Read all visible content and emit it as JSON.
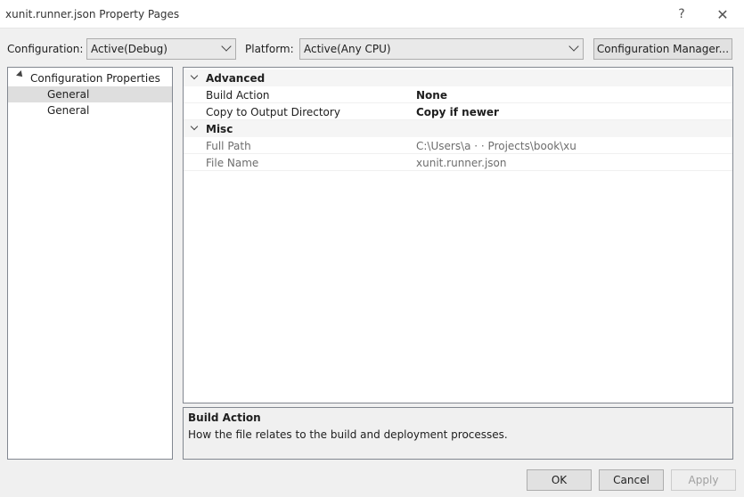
{
  "window": {
    "title": "xunit.runner.json Property Pages",
    "help_label": "?",
    "close_label": "✕"
  },
  "toolbar": {
    "configuration_label": "Configuration:",
    "configuration_value": "Active(Debug)",
    "platform_label": "Platform:",
    "platform_value": "Active(Any CPU)",
    "config_manager_label": "Configuration Manager..."
  },
  "tree": {
    "root_label": "Configuration Properties",
    "items": [
      {
        "label": "General",
        "selected": true
      },
      {
        "label": "General",
        "selected": false
      }
    ]
  },
  "grid": {
    "categories": [
      {
        "label": "Advanced",
        "properties": [
          {
            "name": "Build Action",
            "value": "None"
          },
          {
            "name": "Copy to Output Directory",
            "value": "Copy if newer"
          }
        ]
      },
      {
        "label": "Misc",
        "properties": [
          {
            "name": "Full Path",
            "value": "C:\\Users\\a ·                                    ·                          Projects\\book\\xu"
          },
          {
            "name": "File Name",
            "value": "xunit.runner.json"
          }
        ]
      }
    ]
  },
  "description": {
    "title": "Build Action",
    "text": "How the file relates to the build and deployment processes."
  },
  "buttons": {
    "ok": "OK",
    "cancel": "Cancel",
    "apply": "Apply"
  }
}
